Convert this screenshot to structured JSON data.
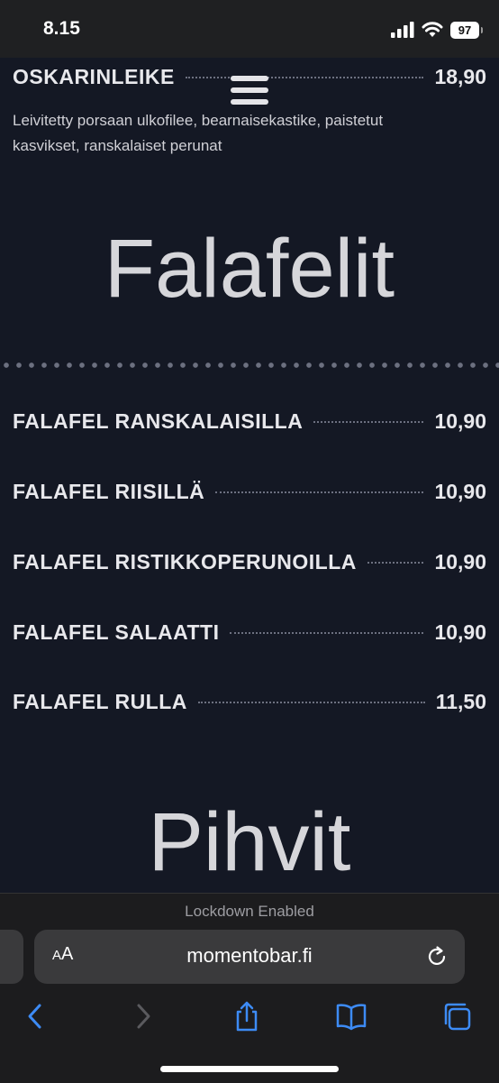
{
  "status_bar": {
    "time": "8.15",
    "battery": "97"
  },
  "menu": {
    "top_item": {
      "name": "OSKARINLEIKE",
      "price": "18,90",
      "description": "Leivitetty porsaan ulkofilee, bearnaisekastike, paistetut kasvikset, ranskalaiset perunat"
    },
    "falafel_section": {
      "title": "Falafelit",
      "items": [
        {
          "name": "FALAFEL RANSKALAISILLA",
          "price": "10,90"
        },
        {
          "name": "FALAFEL RIISILLÄ",
          "price": "10,90"
        },
        {
          "name": "FALAFEL RISTIKKOPERUNOILLA",
          "price": "10,90"
        },
        {
          "name": "FALAFEL SALAATTI",
          "price": "10,90"
        },
        {
          "name": "FALAFEL RULLA",
          "price": "11,50"
        }
      ]
    },
    "next_section": {
      "title": "Pihvit"
    }
  },
  "browser": {
    "lockdown_text": "Lockdown Enabled",
    "aa_small": "A",
    "aa_big": "A",
    "url": "momentobar.fi",
    "accent_color": "#3d8bf5"
  }
}
